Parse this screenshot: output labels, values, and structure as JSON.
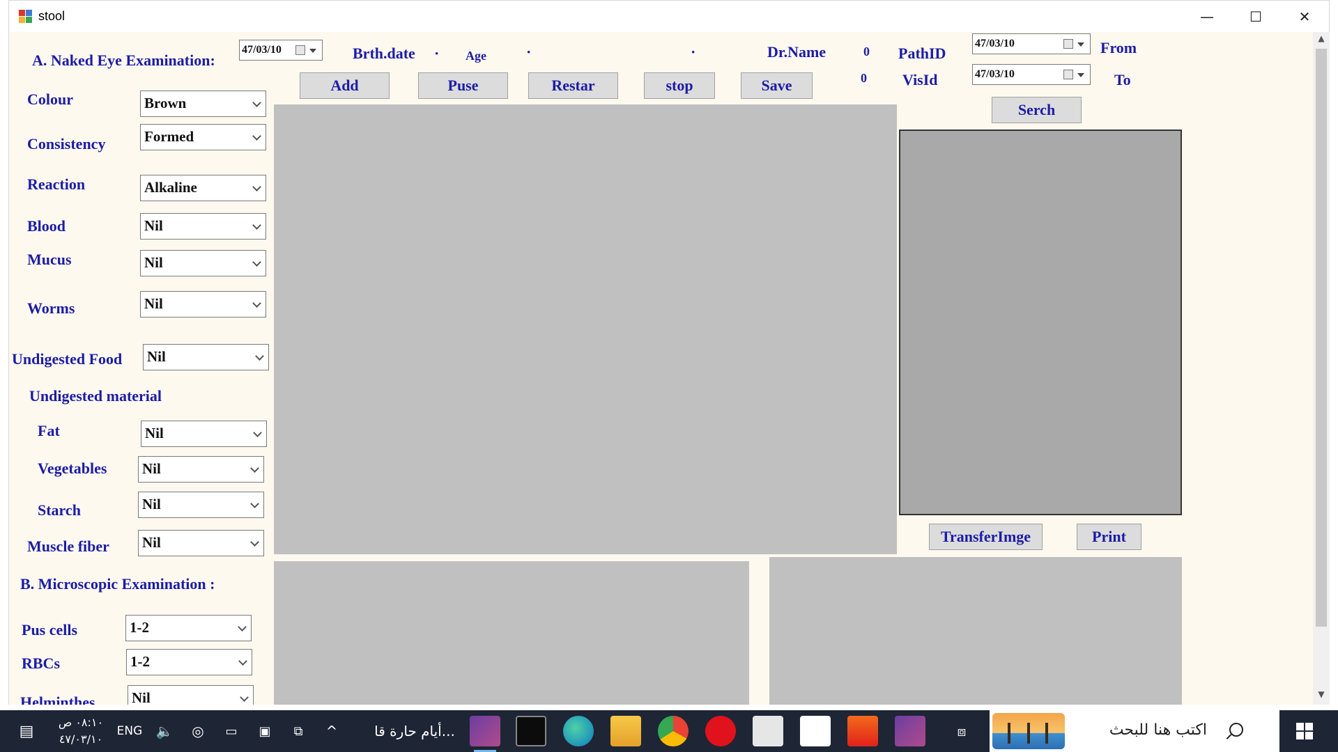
{
  "window": {
    "title": "stool",
    "minimize": "—",
    "maximize": "☐",
    "close": "✕"
  },
  "header": {
    "section_a": "A. Naked Eye Examination:",
    "date_value": "47/03/10",
    "birth_label": "Brth.date",
    "birth_value": "·",
    "age_label": "Age",
    "age_value": "·",
    "dot_value": "·",
    "dr_label": "Dr.Name",
    "path_count": "0",
    "vis_count": "0",
    "path_label": "PathID",
    "vis_label": "VisId",
    "from_date": "47/03/10",
    "to_date": "47/03/10",
    "from_label": "From",
    "to_label": "To"
  },
  "buttons": {
    "add": "Add",
    "pause": "Puse",
    "restart": "Restar",
    "stop": "stop",
    "save": "Save",
    "search": "Serch",
    "transfer": "TransferImge",
    "print": "Print"
  },
  "fields": {
    "colour": {
      "label": "Colour",
      "value": "Brown"
    },
    "consistency": {
      "label": "Consistency",
      "value": "Formed"
    },
    "reaction": {
      "label": "Reaction",
      "value": "Alkaline"
    },
    "blood": {
      "label": "Blood",
      "value": "Nil"
    },
    "mucus": {
      "label": "Mucus",
      "value": "Nil"
    },
    "worms": {
      "label": "Worms",
      "value": "Nil"
    },
    "undigested_food": {
      "label": "Undigested Food",
      "value": "Nil"
    },
    "undigested_material": {
      "label": "Undigested material"
    },
    "fat": {
      "label": "Fat",
      "value": "Nil"
    },
    "vegetables": {
      "label": "Vegetables",
      "value": "Nil"
    },
    "starch": {
      "label": "Starch",
      "value": "Nil"
    },
    "muscle_fiber": {
      "label": "Muscle fiber",
      "value": "Nil"
    },
    "section_b": "B. Microscopic Examination :",
    "pus_cells": {
      "label": "Pus cells",
      "value": "1-2"
    },
    "rbcs": {
      "label": "RBCs",
      "value": "1-2"
    },
    "helminthes": {
      "label": "Helminthes",
      "value": "Nil"
    }
  },
  "taskbar": {
    "time": "٠٨:١٠ ص",
    "date": "٤٧/٠٣/١٠",
    "lang": "ENG",
    "weather": "أيام حارة قا...",
    "search_placeholder": "اكتب هنا للبحث",
    "colors": {
      "bar": "#1e2535",
      "accent": "#76b9ed"
    }
  }
}
